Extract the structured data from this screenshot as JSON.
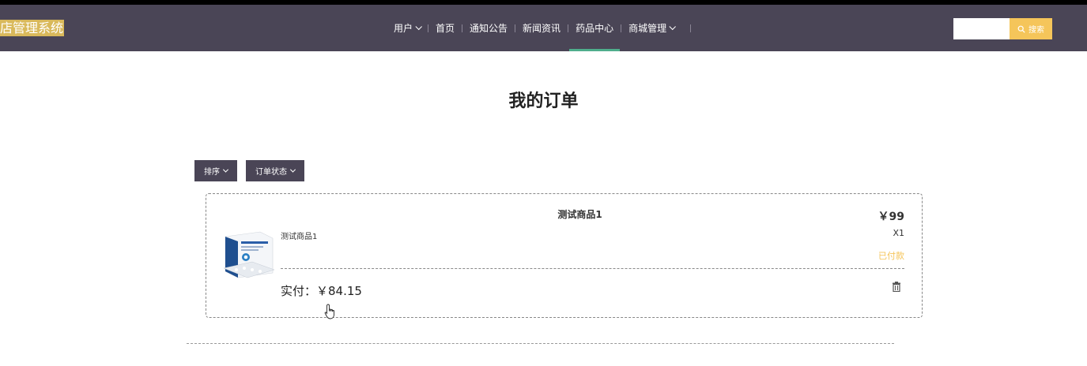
{
  "header": {
    "brand": "店管理系统",
    "nav": [
      {
        "label": "用户",
        "dropdown": true
      },
      {
        "label": "首页",
        "dropdown": false
      },
      {
        "label": "通知公告",
        "dropdown": false
      },
      {
        "label": "新闻资讯",
        "dropdown": false
      },
      {
        "label": "药品中心",
        "dropdown": false,
        "active": true
      },
      {
        "label": "商城管理",
        "dropdown": true
      }
    ],
    "search": {
      "placeholder": "",
      "button_label": "搜索"
    }
  },
  "page": {
    "title": "我的订单"
  },
  "filters": {
    "sort_label": "排序",
    "status_label": "订单状态"
  },
  "order": {
    "title": "测试商品1",
    "name": "测试商品1",
    "price": "￥99",
    "quantity": "X1",
    "status": "已付款",
    "paid": "实付：￥84.15"
  },
  "colors": {
    "nav_bg": "#4a4556",
    "accent": "#f5c55a",
    "active_underline": "#4fae8c"
  }
}
